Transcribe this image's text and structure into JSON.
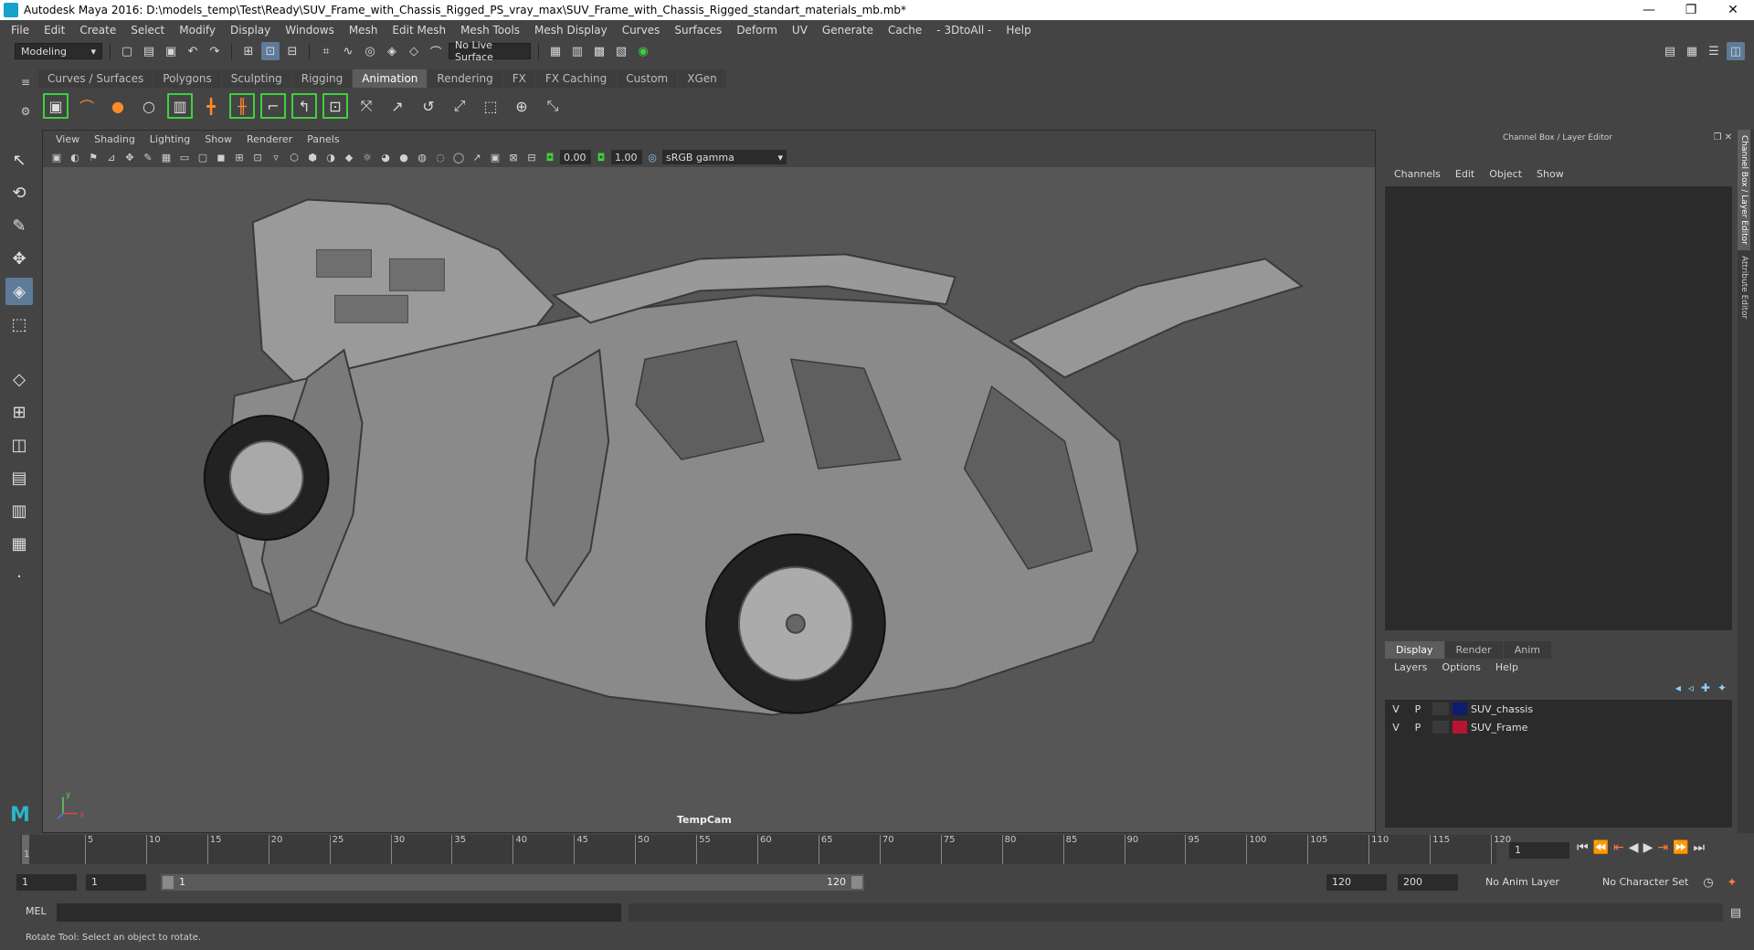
{
  "title_bar": {
    "text": "Autodesk Maya 2016: D:\\models_temp\\Test\\Ready\\SUV_Frame_with_Chassis_Rigged_PS_vray_max\\SUV_Frame_with_Chassis_Rigged_standart_materials_mb.mb*",
    "minimize": "—",
    "restore": "❐",
    "close": "✕"
  },
  "menubar": [
    "File",
    "Edit",
    "Create",
    "Select",
    "Modify",
    "Display",
    "Windows",
    "Mesh",
    "Edit Mesh",
    "Mesh Tools",
    "Mesh Display",
    "Curves",
    "Surfaces",
    "Deform",
    "UV",
    "Generate",
    "Cache",
    "- 3DtoAll -",
    "Help"
  ],
  "status_line": {
    "mode": "Modeling",
    "live_surface": "No Live Surface"
  },
  "shelf": {
    "tabs": [
      "Curves / Surfaces",
      "Polygons",
      "Sculpting",
      "Rigging",
      "Animation",
      "Rendering",
      "FX",
      "FX Caching",
      "Custom",
      "XGen"
    ],
    "active_tab": "Animation"
  },
  "viewport": {
    "menu": [
      "View",
      "Shading",
      "Lighting",
      "Show",
      "Renderer",
      "Panels"
    ],
    "exposure": "0.00",
    "gamma": "1.00",
    "color_space": "sRGB gamma",
    "camera": "TempCam",
    "axis_y": "y",
    "axis_x": "x"
  },
  "channel_box": {
    "header": "Channel Box / Layer Editor",
    "menu": [
      "Channels",
      "Edit",
      "Object",
      "Show"
    ],
    "layer_tabs": [
      "Display",
      "Render",
      "Anim"
    ],
    "layer_menu": [
      "Layers",
      "Options",
      "Help"
    ],
    "layers": [
      {
        "v": "V",
        "p": "P",
        "name": "SUV_chassis",
        "color": "#0f1d6e"
      },
      {
        "v": "V",
        "p": "P",
        "name": "SUV_Frame",
        "color": "#b81432"
      }
    ],
    "side_tabs": [
      "Channel Box / Layer Editor",
      "Attribute Editor"
    ]
  },
  "timeline": {
    "ticks": [
      "5",
      "10",
      "15",
      "20",
      "25",
      "30",
      "35",
      "40",
      "45",
      "50",
      "55",
      "60",
      "65",
      "70",
      "75",
      "80",
      "85",
      "90",
      "95",
      "100",
      "105",
      "110",
      "115",
      "120"
    ],
    "current_frame": "1",
    "start_frame": "1"
  },
  "range": {
    "start": "1",
    "playback_start": "1",
    "slider_start": "1",
    "slider_end": "120",
    "playback_end": "120",
    "end": "200",
    "anim_layer": "No Anim Layer",
    "character_set": "No Character Set"
  },
  "command_line": {
    "label": "MEL"
  },
  "help_line": {
    "text": "Rotate Tool: Select an object to rotate."
  }
}
